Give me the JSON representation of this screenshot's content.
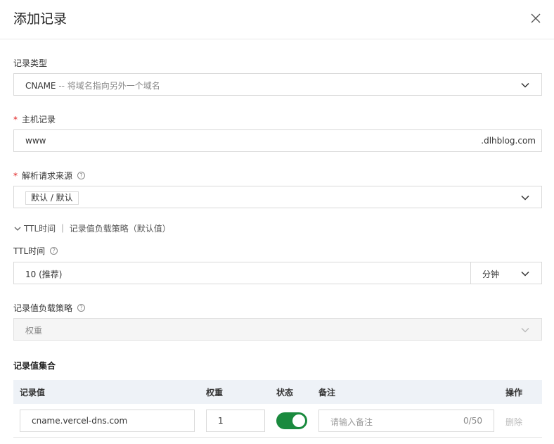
{
  "dialog": {
    "title": "添加记录"
  },
  "record_type": {
    "label": "记录类型",
    "value": "CNAME",
    "description": "-- 将域名指向另外一个域名"
  },
  "host_record": {
    "required_mark": "*",
    "label": "主机记录",
    "value": "www",
    "suffix": ".dlhblog.com"
  },
  "resolve_source": {
    "required_mark": "*",
    "label": "解析请求来源",
    "help": "?",
    "tag": "默认 / 默认"
  },
  "advanced": {
    "toggle_icon": "chevron-down-icon",
    "text": "TTL时间 ｜ 记录值负载策略（默认值）"
  },
  "ttl": {
    "label": "TTL时间",
    "help": "?",
    "value": "10 (推荐)",
    "unit": "分钟"
  },
  "strategy": {
    "label": "记录值负载策略",
    "help": "?",
    "value": "权重"
  },
  "records": {
    "title": "记录值集合",
    "columns": {
      "value": "记录值",
      "weight": "权重",
      "status": "状态",
      "note": "备注",
      "action": "操作"
    },
    "rows": [
      {
        "value": "cname.vercel-dns.com",
        "weight": "1",
        "status_on": true,
        "note_placeholder": "请输入备注",
        "note_count": "0/50",
        "action": "删除"
      }
    ]
  },
  "colors": {
    "toggle_on": "#1a8a3e",
    "required": "#e02020",
    "header_bg": "#eef2f7"
  }
}
